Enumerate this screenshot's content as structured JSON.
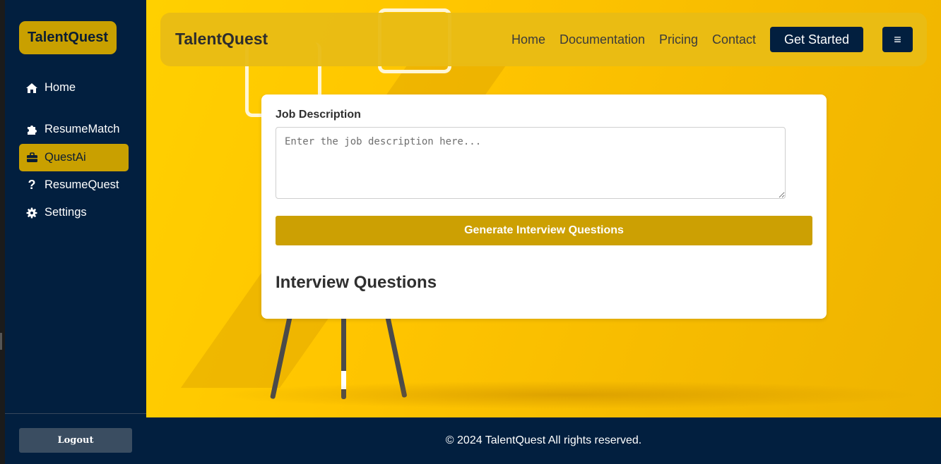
{
  "sidebar": {
    "brand": "TalentQuest",
    "items": [
      {
        "label": "Home",
        "icon": "home-icon"
      },
      {
        "label": "ResumeMatch",
        "icon": "puzzle-icon"
      },
      {
        "label": "QuestAi",
        "icon": "briefcase-icon",
        "active": true
      },
      {
        "label": "ResumeQuest",
        "icon": "question-icon"
      },
      {
        "label": "Settings",
        "icon": "gear-icon"
      }
    ],
    "logout_label": "Logout"
  },
  "header": {
    "title": "TalentQuest",
    "nav": [
      "Home",
      "Documentation",
      "Pricing",
      "Contact"
    ],
    "cta_label": "Get Started",
    "menu_icon": "hamburger-menu-icon",
    "menu_glyph": "≡"
  },
  "form": {
    "label": "Job Description",
    "placeholder": "Enter the job description here...",
    "value": "",
    "button_label": "Generate Interview Questions",
    "results_heading": "Interview Questions"
  },
  "footer": {
    "text": "© 2024 TalentQuest All rights reserved."
  },
  "colors": {
    "navy": "#021f3f",
    "gold": "#c9a000",
    "button_gold": "#cca003",
    "background_yellow": "#ffc500"
  }
}
